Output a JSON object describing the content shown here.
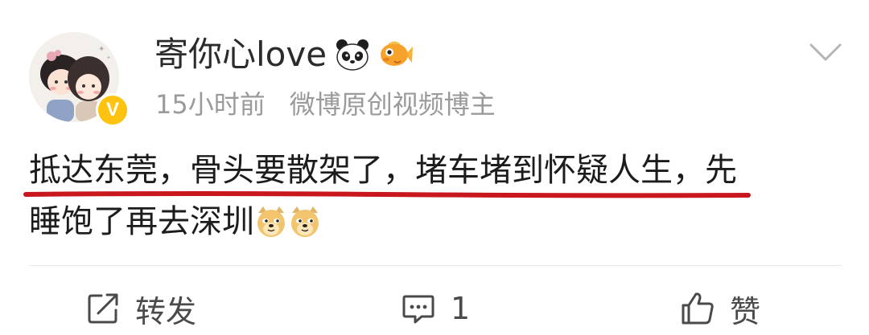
{
  "post": {
    "author": {
      "name": "寄你心love",
      "verified_mark": "V",
      "badges": [
        "panda-icon",
        "goldfish-icon"
      ]
    },
    "meta": {
      "time": "15小时前",
      "source": "微博原创视频博主"
    },
    "content": {
      "line1": "抵达东莞，骨头要散架了，堵车堵到怀疑人生，先",
      "line2": "睡饱了再去深圳",
      "emojis": [
        "doge-icon",
        "doge-icon"
      ],
      "highlight_color": "#c8181e"
    },
    "actions": {
      "repost_label": "转发",
      "comment_count": "1",
      "like_label": "赞"
    },
    "colors": {
      "verified": "#ffc20e",
      "meta_text": "#9a9a9a",
      "divider": "#e8e8e8"
    }
  }
}
